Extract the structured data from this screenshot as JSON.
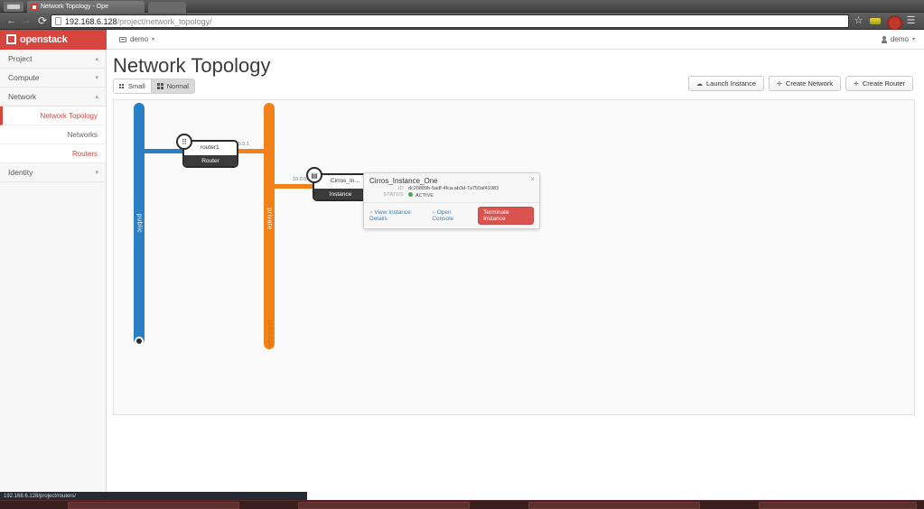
{
  "browser": {
    "tab_title": "Network Topology - Ope",
    "url_host": "192.168.6.128",
    "url_path": "/project/network_topology/",
    "back_icon": "back-arrow-icon",
    "forward_icon": "forward-arrow-icon",
    "reload_icon": "reload-icon",
    "star_icon": "bookmark-star-icon",
    "menu_icon": "hamburger-menu-icon"
  },
  "topbar": {
    "brand": "openstack",
    "project": "demo",
    "user": "demo",
    "caret": "▾"
  },
  "sidebar": {
    "groups": [
      {
        "label": "Project",
        "chevron": "▴"
      },
      {
        "label": "Compute",
        "chevron": "▾"
      },
      {
        "label": "Network",
        "chevron": "▴"
      },
      {
        "label": "Identity",
        "chevron": "▾"
      }
    ],
    "network_items": [
      {
        "label": "Network Topology",
        "active": true
      },
      {
        "label": "Networks",
        "active": false
      },
      {
        "label": "Routers",
        "active": false
      }
    ]
  },
  "page": {
    "title": "Network Topology",
    "view_small": "Small",
    "view_normal": "Normal",
    "active_view": "Normal"
  },
  "actions": [
    {
      "label": "Launch Instance",
      "glyph": "☁",
      "icon": "cloud-upload-icon"
    },
    {
      "label": "Create Network",
      "glyph": "✛",
      "icon": "plus-icon"
    },
    {
      "label": "Create Router",
      "glyph": "✛",
      "icon": "plus-icon"
    }
  ],
  "topology": {
    "networks": [
      {
        "name": "public",
        "color": "#2a7fc2",
        "subnet": ""
      },
      {
        "name": "private",
        "color": "#f28119",
        "subnet": "10.0.0.0/24"
      }
    ],
    "nodes": [
      {
        "name": "router1",
        "type": "Router",
        "icon": "router-icon"
      },
      {
        "name": "Cirros_In…",
        "type": "Instance",
        "icon": "instance-icon"
      }
    ],
    "ip_labels": [
      {
        "text": "10.0.0.1"
      },
      {
        "text": "10.0.0.4"
      }
    ]
  },
  "popup": {
    "title": "Cirros_Instance_One",
    "id_key": "ID",
    "id_value": "dc20889b-5adf-4fca-ab3d-7a750af41083",
    "status_key": "STATUS",
    "status_value": "ACTIVE",
    "status_color": "#4ca54c",
    "link_details": "View Instance Details",
    "link_console": "Open Console",
    "btn_terminate": "Terminate Instance",
    "close_glyph": "×"
  },
  "statusbar": {
    "url": "192.168.6.128/project/routers/"
  }
}
